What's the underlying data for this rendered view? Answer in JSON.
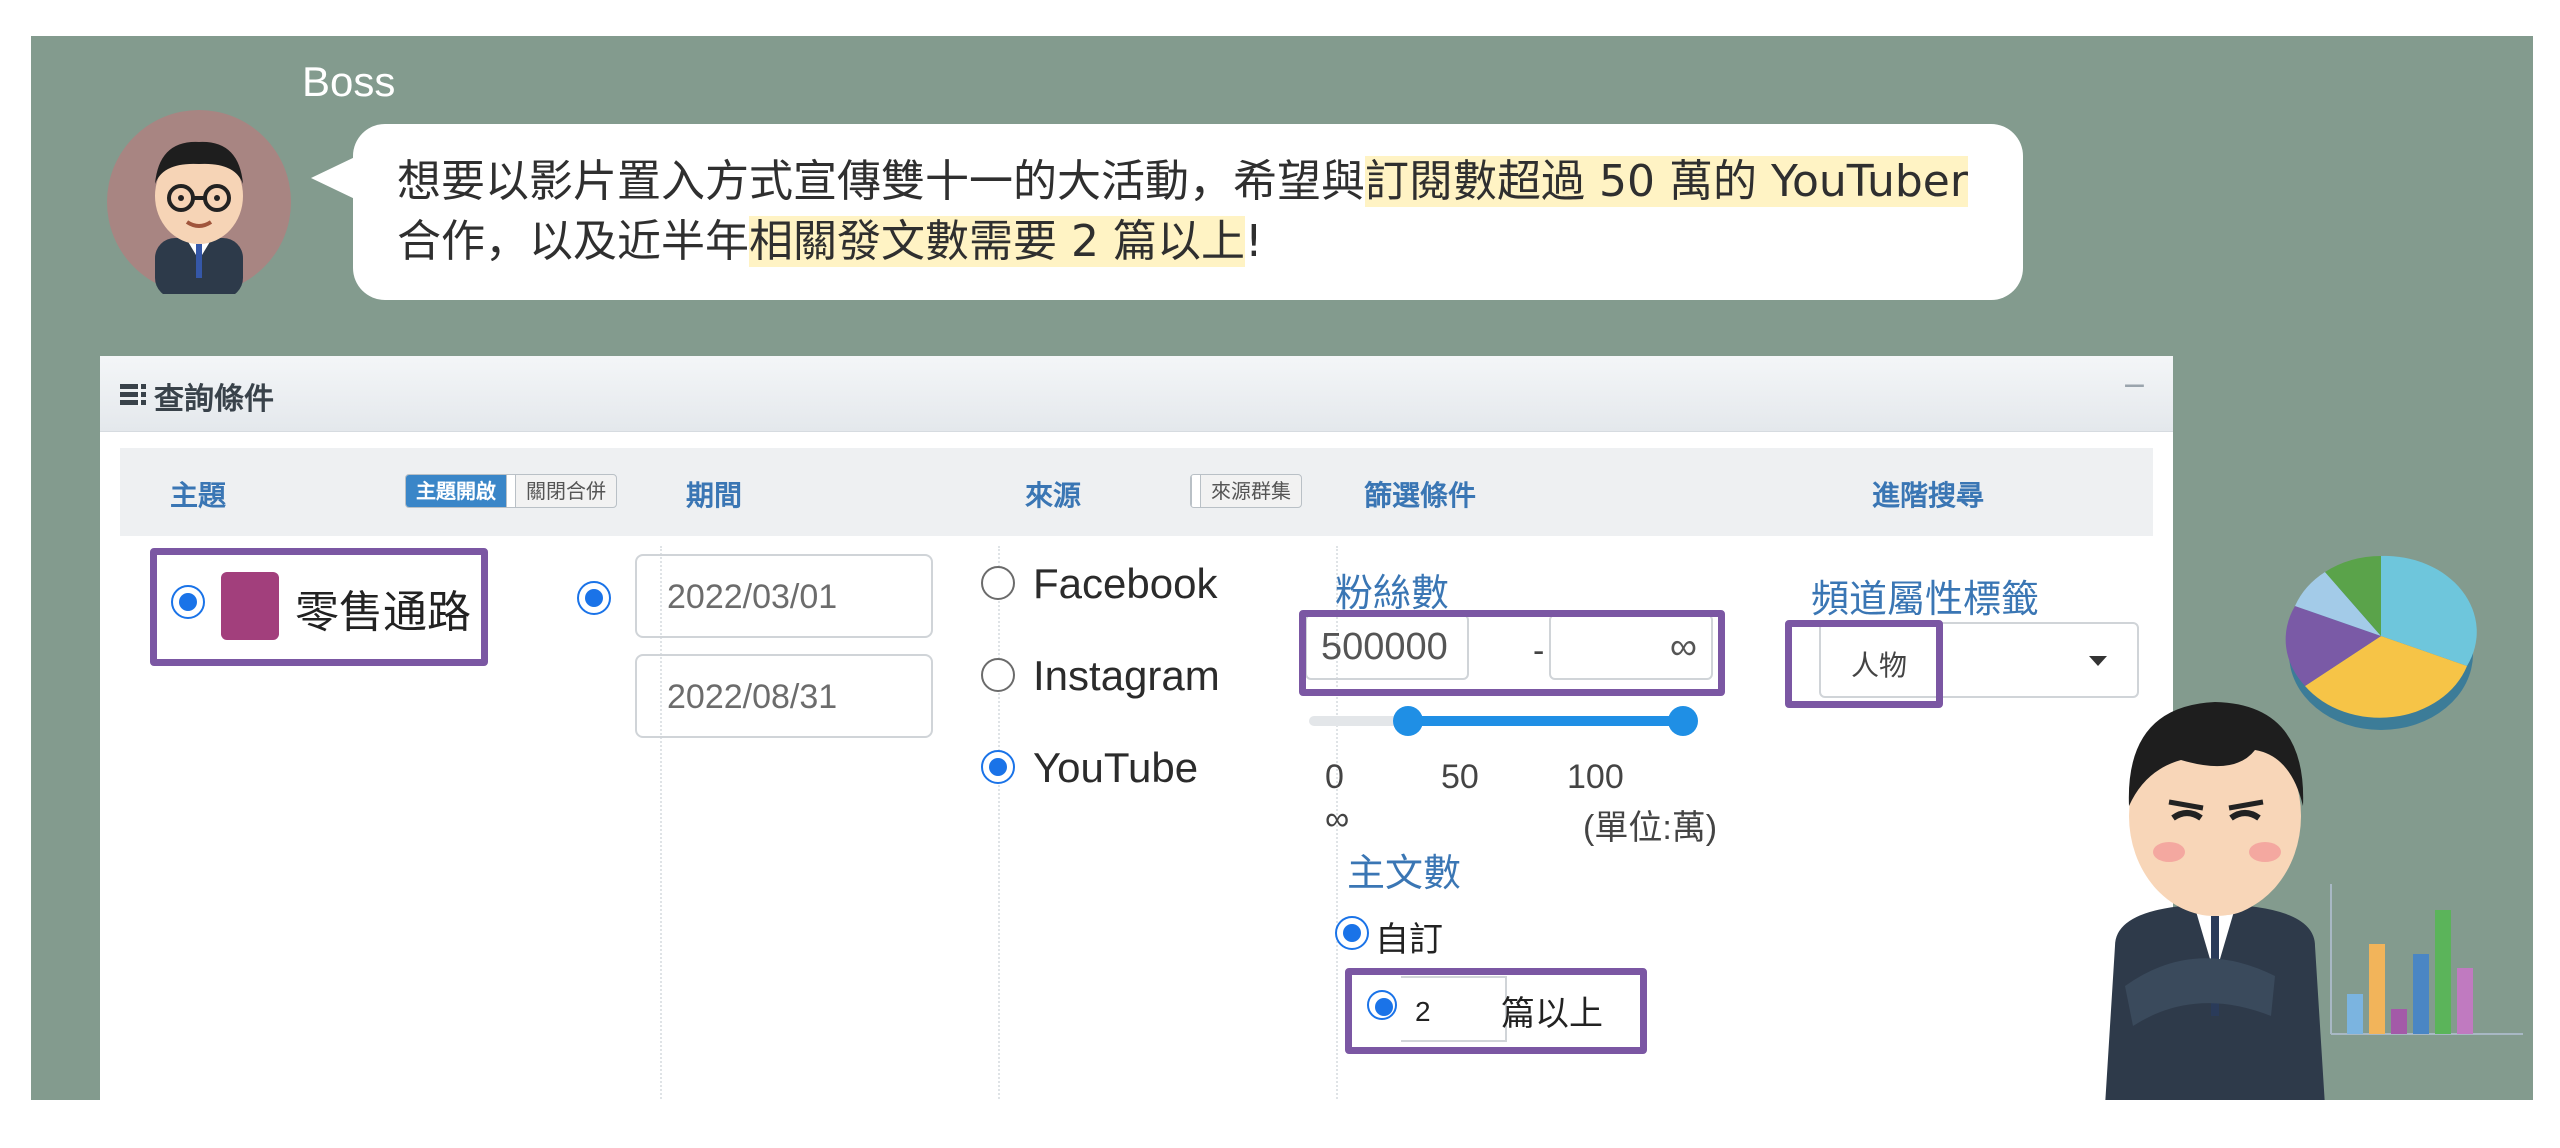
{
  "boss": {
    "name": "Boss",
    "message_part1": "想要以影片置入方式宣傳雙十一的大活動，希望與",
    "message_hl1": "訂閱數超過 50 萬的 YouTuber",
    "message_part2": " 合作，以及近半年",
    "message_hl2": "相關發文數需要 2 篇以上",
    "message_end": "!"
  },
  "panel": {
    "title": "查詢條件",
    "minimize": "−"
  },
  "columns": {
    "topic": "主題",
    "topic_toggle_on": "主題開啟",
    "topic_toggle_off": "關閉合併",
    "period": "期間",
    "source": "來源",
    "source_toggle": "來源群集",
    "filter": "篩選條件",
    "advanced": "進階搜尋"
  },
  "topic": {
    "item_label": "零售通路",
    "swatch_color": "#a23f7c",
    "selected": true
  },
  "period": {
    "selected": true,
    "start": "2022/03/01",
    "end": "2022/08/31"
  },
  "sources": {
    "options": [
      "Facebook",
      "Instagram",
      "YouTube"
    ],
    "selected": "YouTube"
  },
  "filters": {
    "fans_label": "粉絲數",
    "fans_min": "500000",
    "range_separator": "-",
    "fans_max": "∞",
    "slider_low_fraction": 0.26,
    "slider_high_fraction": 0.98,
    "slider_ticks": [
      "0",
      "50",
      "100",
      "∞"
    ],
    "slider_unit": "(單位:萬)",
    "posts_label": "主文數",
    "posts_mode": "自訂",
    "posts_count": "2",
    "posts_suffix": "篇以上"
  },
  "advanced": {
    "channel_tag_label": "頻道屬性標籤",
    "channel_tag_value": "人物"
  },
  "colors": {
    "background": "#839b8e",
    "highlight_border": "#7b57a3",
    "accent": "#1a73e8",
    "header_text": "#3a76b4",
    "text_highlight": "#fff3c4"
  }
}
